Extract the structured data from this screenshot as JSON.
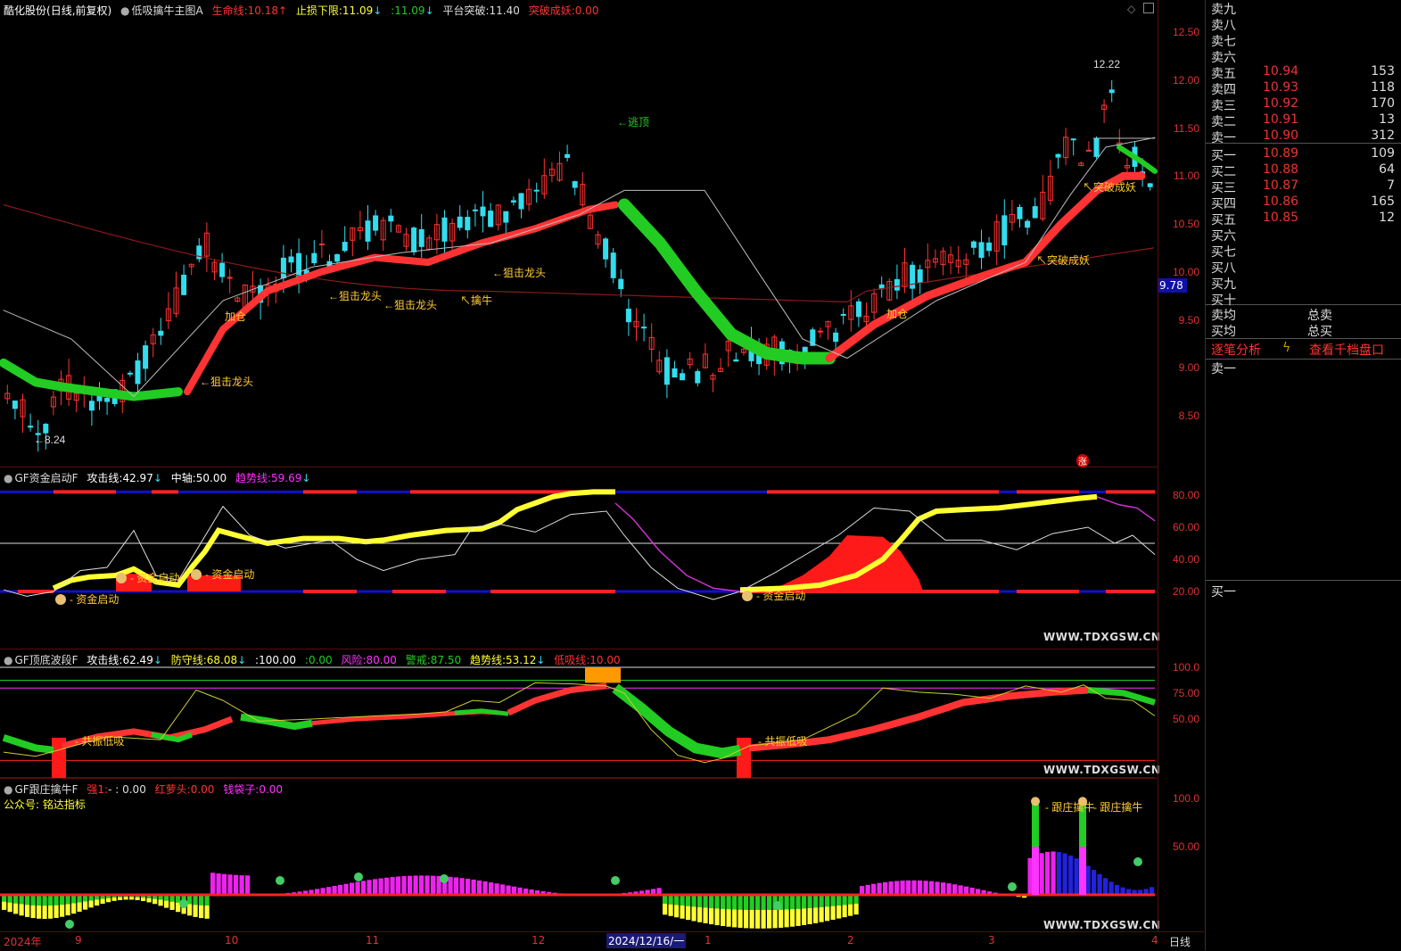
{
  "main": {
    "stock": "酷化股份",
    "mode": "(日线,前复权)",
    "indicator": "低吸擒牛主图A",
    "life_label": "生命线:",
    "life_val": "10.18",
    "life_arrow": "↑",
    "stop_label": "止损下限:",
    "stop_val": "11.09",
    "stop_arrow": "↓",
    "stop2_label": ":",
    "stop2_val": "11.09",
    "stop2_arrow": "↓",
    "plat_label": "平台突破:",
    "plat_val": "11.40",
    "break_label": "突破成妖:",
    "break_val": "0.00",
    "y_ticks": [
      "12.50",
      "12.00",
      "11.50",
      "11.00",
      "10.50",
      "10.00",
      "9.50",
      "9.00",
      "8.50"
    ],
    "current_price": "9.78",
    "high_label": "12.22",
    "low_label": "8.24",
    "annotations": [
      "←逃顶",
      "←狙击龙头",
      "←狙击龙头",
      "←狙击龙头",
      "←狙击龙头",
      "↖擒牛",
      "加仓",
      "↖突破成妖",
      "↖突破成妖",
      "加仓",
      "←狙击龙头",
      "←狙击龙头"
    ],
    "limit_mark": "涨"
  },
  "ind1": {
    "name": "GF资金启动F",
    "l1": "攻击线:",
    "v1": "42.97",
    "a1": "↓",
    "l2": "中轴:",
    "v2": "50.00",
    "l3": "趋势线:",
    "v3": "59.69",
    "a3": "↓",
    "y_ticks": [
      "80.00",
      "60.00",
      "40.00",
      "20.00"
    ],
    "ann": [
      "资金启动",
      "资金启动",
      "资金启动",
      "资金启动"
    ],
    "watermark": "WWW.TDXGSW.CN"
  },
  "ind2": {
    "name": "GF顶底波段F",
    "l1": "攻击线:",
    "v1": "62.49",
    "a1": "↓",
    "l2": "防守线:",
    "v2": "68.08",
    "a2": "↓",
    "l3": ":",
    "v3": "100.00",
    "l4": ":",
    "v4": "0.00",
    "l5": "风险:",
    "v5": "80.00",
    "l6": "警戒:",
    "v6": "87.50",
    "l7": "趋势线:",
    "v7": "53.12",
    "a7": "↓",
    "l8": "低吸线:",
    "v8": "10.00",
    "y_ticks": [
      "100.0",
      "75.00",
      "50.00"
    ],
    "ann": [
      "共振低吸",
      "共振低吸"
    ],
    "watermark": "WWW.TDXGSW.CN"
  },
  "ind3": {
    "name": "GF跟庄擒牛F",
    "l1": "强1:",
    "v1": "- : 0.00",
    "l2": "红萝头:",
    "v2": "0.00",
    "l3": "钱袋子:",
    "v3": "0.00",
    "sub": "公众号: 铭达指标",
    "y_ticks": [
      "100.0",
      "50.00"
    ],
    "ann": [
      "跟庄擒牛",
      "跟庄擒牛"
    ],
    "watermark": "WWW.TDXGSW.CN"
  },
  "xaxis": {
    "labels": [
      "2024年",
      "9",
      "10",
      "11",
      "12",
      "2024/12/16/一",
      "1",
      "2",
      "3",
      "4"
    ],
    "period": "日线"
  },
  "orderbook": {
    "sell": [
      {
        "l": "卖九",
        "p": "",
        "v": ""
      },
      {
        "l": "卖八",
        "p": "",
        "v": ""
      },
      {
        "l": "卖七",
        "p": "",
        "v": ""
      },
      {
        "l": "卖六",
        "p": "",
        "v": ""
      },
      {
        "l": "卖五",
        "p": "10.94",
        "v": "153"
      },
      {
        "l": "卖四",
        "p": "10.93",
        "v": "118"
      },
      {
        "l": "卖三",
        "p": "10.92",
        "v": "170"
      },
      {
        "l": "卖二",
        "p": "10.91",
        "v": "13"
      },
      {
        "l": "卖一",
        "p": "10.90",
        "v": "312"
      }
    ],
    "buy": [
      {
        "l": "买一",
        "p": "10.89",
        "v": "109"
      },
      {
        "l": "买二",
        "p": "10.88",
        "v": "64"
      },
      {
        "l": "买三",
        "p": "10.87",
        "v": "7"
      },
      {
        "l": "买四",
        "p": "10.86",
        "v": "165"
      },
      {
        "l": "买五",
        "p": "10.85",
        "v": "12"
      },
      {
        "l": "买六",
        "p": "",
        "v": ""
      },
      {
        "l": "买七",
        "p": "",
        "v": ""
      },
      {
        "l": "买八",
        "p": "",
        "v": ""
      },
      {
        "l": "买九",
        "p": "",
        "v": ""
      },
      {
        "l": "买十",
        "p": "",
        "v": ""
      }
    ],
    "avg_sell": "卖均",
    "total_sell": "总卖",
    "avg_buy": "买均",
    "total_buy": "总买",
    "tick_analysis": "逐笔分析",
    "view_1000": "查看千档盘口",
    "sell1_tab": "卖一",
    "buy1_tab": "买一"
  },
  "colors": {
    "up": "#ff3333",
    "down": "#33ddee",
    "yellow": "#ffff33",
    "green": "#22cc22",
    "magenta": "#ff33ff",
    "blue": "#1010cc"
  }
}
